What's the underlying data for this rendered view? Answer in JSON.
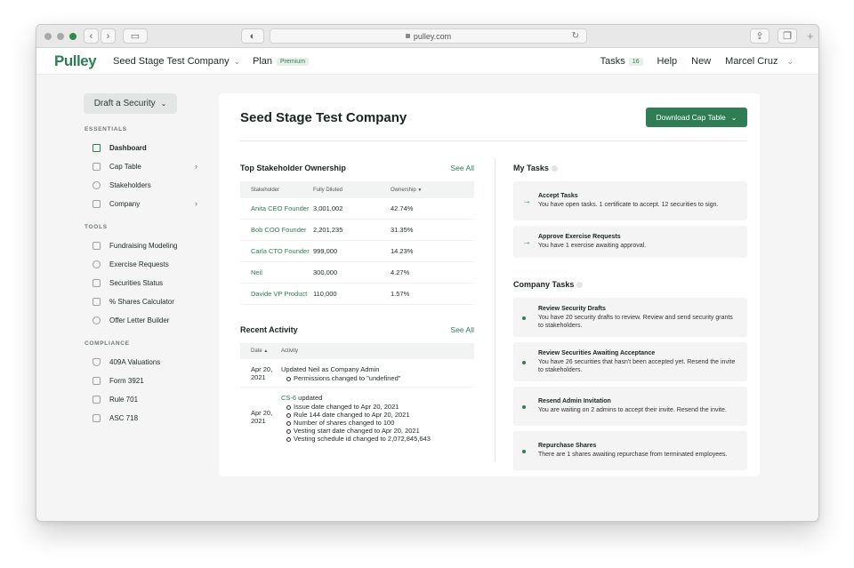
{
  "browser": {
    "url": "pulley.com"
  },
  "header": {
    "logo": "Pulley",
    "company": "Seed Stage Test Company",
    "plan_label": "Plan",
    "plan_badge": "Premium",
    "tasks_label": "Tasks",
    "tasks_count": "16",
    "help": "Help",
    "new": "New",
    "user": "Marcel Cruz"
  },
  "sidebar": {
    "draft_button": "Draft a Security",
    "sections": {
      "essentials": "ESSENTIALS",
      "tools": "TOOLS",
      "compliance": "COMPLIANCE"
    },
    "essentials": [
      "Dashboard",
      "Cap Table",
      "Stakeholders",
      "Company"
    ],
    "tools": [
      "Fundraising Modeling",
      "Exercise Requests",
      "Securities Status",
      "% Shares Calculator",
      "Offer Letter Builder"
    ],
    "compliance": [
      "409A Valuations",
      "Form 3921",
      "Rule 701",
      "ASC 718"
    ]
  },
  "main": {
    "title": "Seed Stage Test Company",
    "download_button": "Download Cap Table",
    "ownership": {
      "heading": "Top Stakeholder Ownership",
      "see_all": "See All",
      "columns": [
        "Stakeholder",
        "Fully Diluted",
        "Ownership"
      ],
      "rows": [
        {
          "name": "Anita CEO Founder",
          "diluted": "3,001,002",
          "own": "42.74%"
        },
        {
          "name": "Bob COO Founder",
          "diluted": "2,201,235",
          "own": "31.35%"
        },
        {
          "name": "Carla CTO Founder",
          "diluted": "999,000",
          "own": "14.23%"
        },
        {
          "name": "Neil",
          "diluted": "300,000",
          "own": "4.27%"
        },
        {
          "name": "Davide VP Product",
          "diluted": "110,000",
          "own": "1.57%"
        }
      ]
    },
    "activity": {
      "heading": "Recent Activity",
      "see_all": "See All",
      "columns": [
        "Date",
        "Activity"
      ],
      "row1": {
        "date1": "Apr 20,",
        "date2": "2021",
        "title": "Updated Neil as Company Admin",
        "items": [
          "Permissions changed to \"undefined\""
        ]
      },
      "row2": {
        "date1": "Apr 20,",
        "date2": "2021",
        "link": "CS-6",
        "title_suffix": " updated",
        "items": [
          "Issue date changed to Apr 20, 2021",
          "Rule 144 date changed to Apr 20, 2021",
          "Number of shares changed to 100",
          "Vesting start date changed to Apr 20, 2021",
          "Vesting schedule id changed to 2,072,845,643"
        ]
      }
    },
    "my_tasks": {
      "heading": "My Tasks",
      "items": [
        {
          "title": "Accept Tasks",
          "desc": "You have open tasks. 1 certificate to accept. 12 securities to sign."
        },
        {
          "title": "Approve Exercise Requests",
          "desc": "You have 1 exercise awaiting approval."
        }
      ]
    },
    "company_tasks": {
      "heading": "Company Tasks",
      "items": [
        {
          "title": "Review Security Drafts",
          "desc": "You have 20 security drafts to review. Review and send security grants to stakeholders."
        },
        {
          "title": "Review Securities Awaiting Acceptance",
          "desc": "You have 26 securities that hasn't been accepted yet. Resend the invite to stakeholders."
        },
        {
          "title": "Resend Admin Invitation",
          "desc": "You are waiting on 2 admins to accept their invite. Resend the invite."
        },
        {
          "title": "Repurchase Shares",
          "desc": "There are 1 shares awaiting repurchase from terminated employees."
        }
      ]
    }
  }
}
